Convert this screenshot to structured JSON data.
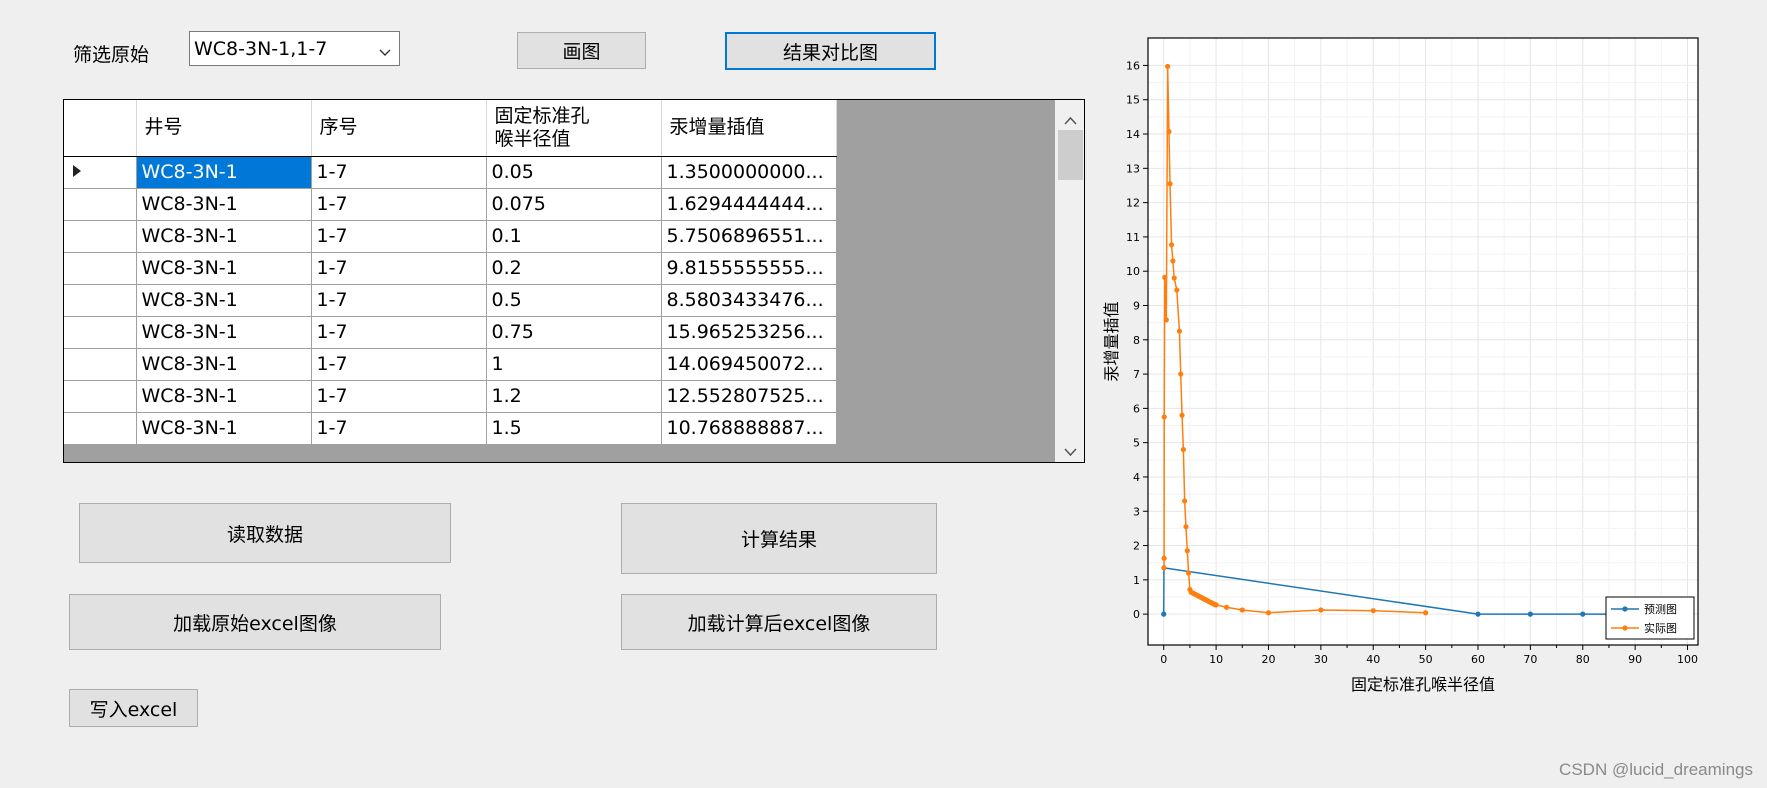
{
  "filter": {
    "label": "筛选原始",
    "value": "WC8-3N-1,1-7"
  },
  "buttons": {
    "plot": "画图",
    "compare": "结果对比图",
    "read": "读取数据",
    "compute": "计算结果",
    "load_orig": "加载原始excel图像",
    "load_calc": "加载计算后excel图像",
    "write": "写入excel"
  },
  "table": {
    "headers": [
      "井号",
      "序号",
      "固定标准孔\n喉半径值",
      "汞增量插值"
    ],
    "rows": [
      [
        "WC8-3N-1",
        "1-7",
        "0.05",
        "1.3500000000..."
      ],
      [
        "WC8-3N-1",
        "1-7",
        "0.075",
        "1.6294444444..."
      ],
      [
        "WC8-3N-1",
        "1-7",
        "0.1",
        "5.7506896551..."
      ],
      [
        "WC8-3N-1",
        "1-7",
        "0.2",
        "9.8155555555..."
      ],
      [
        "WC8-3N-1",
        "1-7",
        "0.5",
        "8.5803433476..."
      ],
      [
        "WC8-3N-1",
        "1-7",
        "0.75",
        "15.965253256..."
      ],
      [
        "WC8-3N-1",
        "1-7",
        "1",
        "14.069450072..."
      ],
      [
        "WC8-3N-1",
        "1-7",
        "1.2",
        "12.552807525..."
      ],
      [
        "WC8-3N-1",
        "1-7",
        "1.5",
        "10.768888887..."
      ]
    ]
  },
  "chart_data": {
    "type": "line",
    "xlabel": "固定标准孔喉半径值",
    "ylabel": "汞增量插值",
    "xlim": [
      -3,
      102
    ],
    "ylim": [
      -0.9,
      16.8
    ],
    "xticks": [
      0,
      10,
      20,
      30,
      40,
      50,
      60,
      70,
      80,
      90,
      100
    ],
    "yticks": [
      0,
      1,
      2,
      3,
      4,
      5,
      6,
      7,
      8,
      9,
      10,
      11,
      12,
      13,
      14,
      15,
      16
    ],
    "grid": true,
    "legend": "bottom-right",
    "series": [
      {
        "name": "预测图",
        "color": "#1f77b4",
        "x": [
          0,
          0.05,
          60,
          70,
          80,
          90
        ],
        "y": [
          0,
          1.35,
          0,
          0,
          0,
          0
        ]
      },
      {
        "name": "实际图",
        "color": "#ff7f0e",
        "x": [
          0.05,
          0.075,
          0.1,
          0.2,
          0.5,
          0.75,
          1,
          1.2,
          1.5,
          1.75,
          2,
          2.5,
          3,
          3.25,
          3.5,
          3.75,
          4,
          4.25,
          4.5,
          4.75,
          5,
          5.25,
          5.5,
          5.75,
          6,
          6.25,
          6.5,
          6.75,
          7,
          7.25,
          7.5,
          7.75,
          8,
          8.25,
          8.5,
          8.75,
          9,
          9.25,
          9.5,
          9.75,
          10,
          12,
          15,
          20,
          30,
          40,
          50
        ],
        "y": [
          1.35,
          1.63,
          5.75,
          9.82,
          8.58,
          15.97,
          14.07,
          12.55,
          10.77,
          10.3,
          9.8,
          9.45,
          8.25,
          7.0,
          5.8,
          4.8,
          3.3,
          2.55,
          1.85,
          1.2,
          0.72,
          0.64,
          0.62,
          0.6,
          0.58,
          0.56,
          0.54,
          0.52,
          0.5,
          0.48,
          0.46,
          0.44,
          0.42,
          0.4,
          0.38,
          0.36,
          0.34,
          0.32,
          0.3,
          0.28,
          0.27,
          0.2,
          0.12,
          0.04,
          0.12,
          0.1,
          0.04
        ]
      }
    ]
  },
  "watermark": "CSDN @lucid_dreamings"
}
